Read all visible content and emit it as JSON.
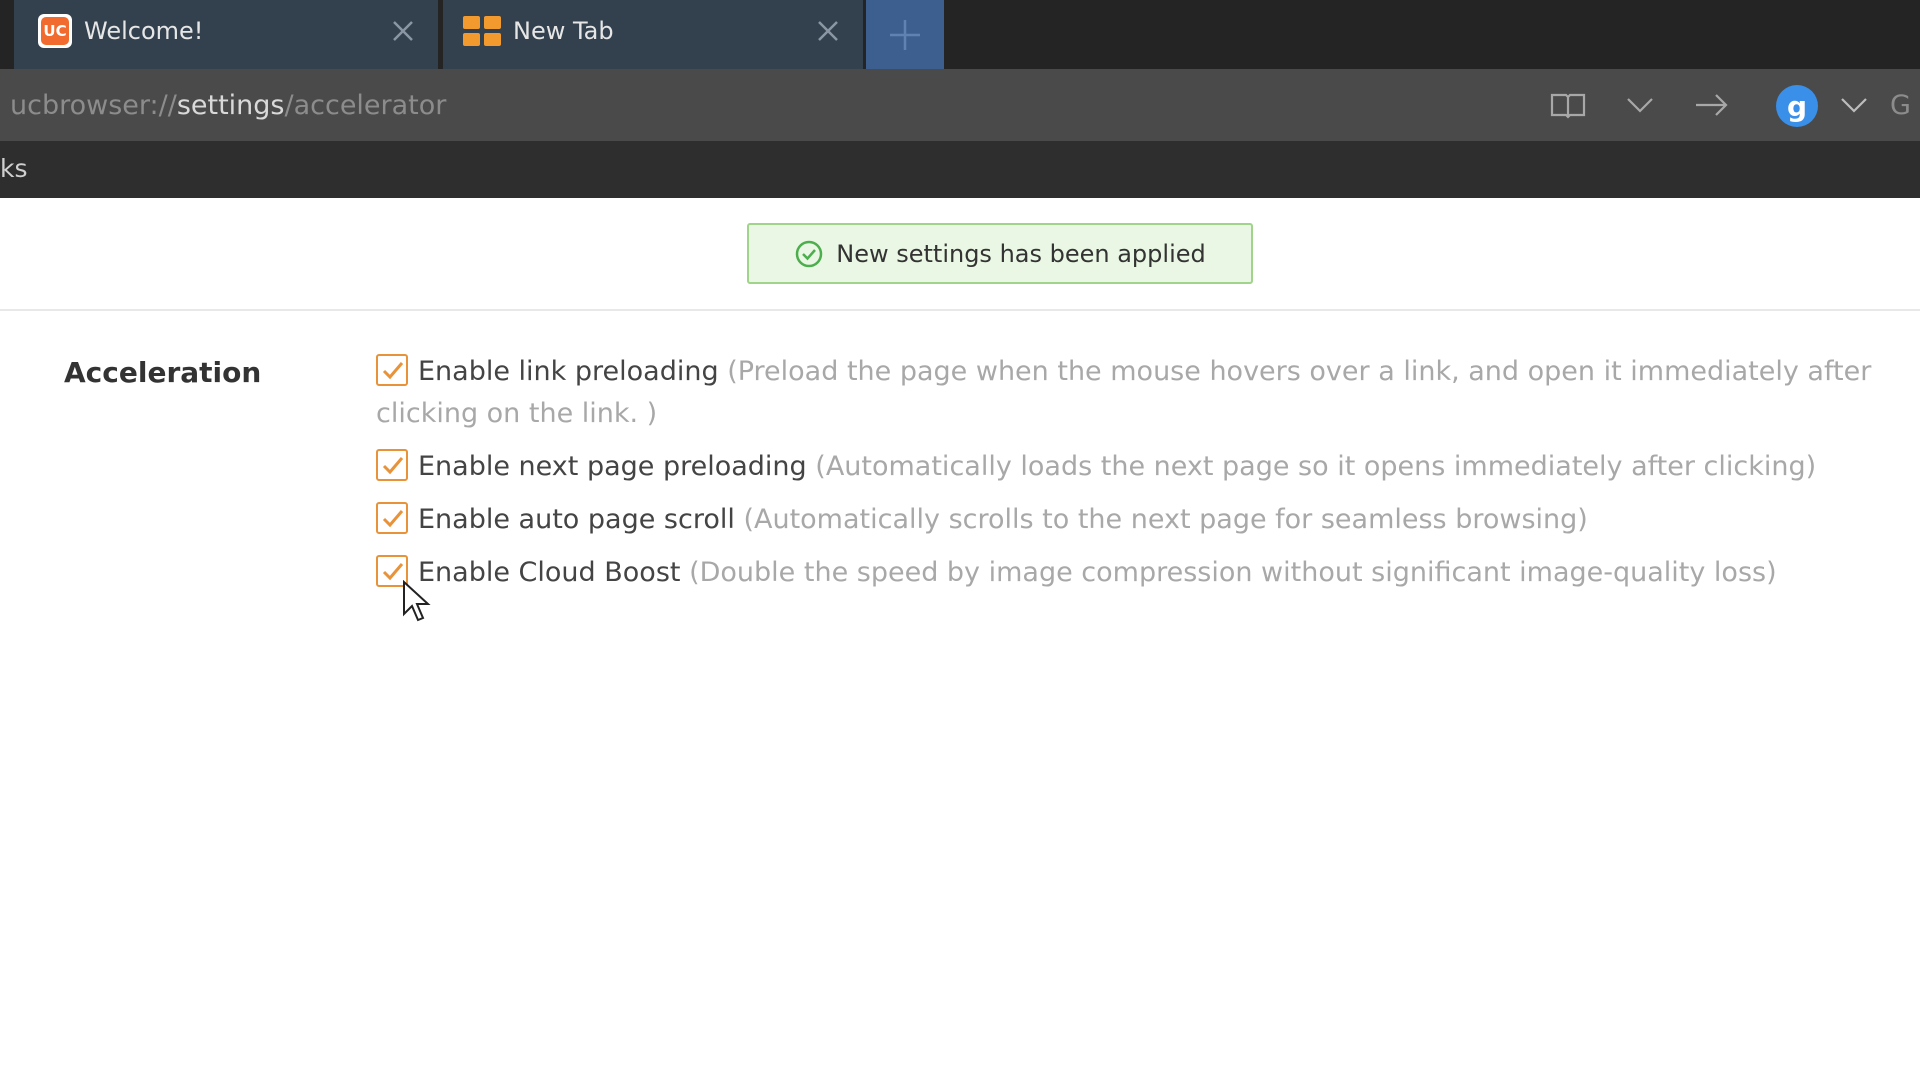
{
  "tabs": [
    {
      "title": "Welcome!",
      "icon": "uc-browser-icon",
      "icon_text": "UC"
    },
    {
      "title": "New Tab",
      "icon": "grid-icon"
    }
  ],
  "address_bar": {
    "url_prefix": "ucbrowser://",
    "url_highlight": "settings",
    "url_suffix": "/accelerator",
    "avatar_letter": "g",
    "trailing_text": "G"
  },
  "bookmarks_bar": {
    "text": "ks"
  },
  "notification": {
    "text": "New settings has been applied",
    "icon": "check-circle-icon"
  },
  "settings": {
    "section_title": "Acceleration",
    "options": [
      {
        "label": "Enable link preloading",
        "description": "(Preload the page when the mouse hovers over a link, and open it immediately after clicking on the link. )",
        "checked": true
      },
      {
        "label": "Enable next page preloading",
        "description": "(Automatically loads the next page so it opens immediately after clicking)",
        "checked": true
      },
      {
        "label": "Enable auto page scroll",
        "description": "(Automatically scrolls to the next page for seamless browsing)",
        "checked": true
      },
      {
        "label": "Enable Cloud Boost",
        "description": "(Double the speed by image compression without significant image-quality loss)",
        "checked": true
      }
    ]
  },
  "colors": {
    "tab_bg": "#33414e",
    "checkbox_accent": "#e8923a",
    "toast_bg": "#eaf7e4",
    "toast_border": "#9fd48a",
    "avatar_blue": "#3a8fe8"
  }
}
